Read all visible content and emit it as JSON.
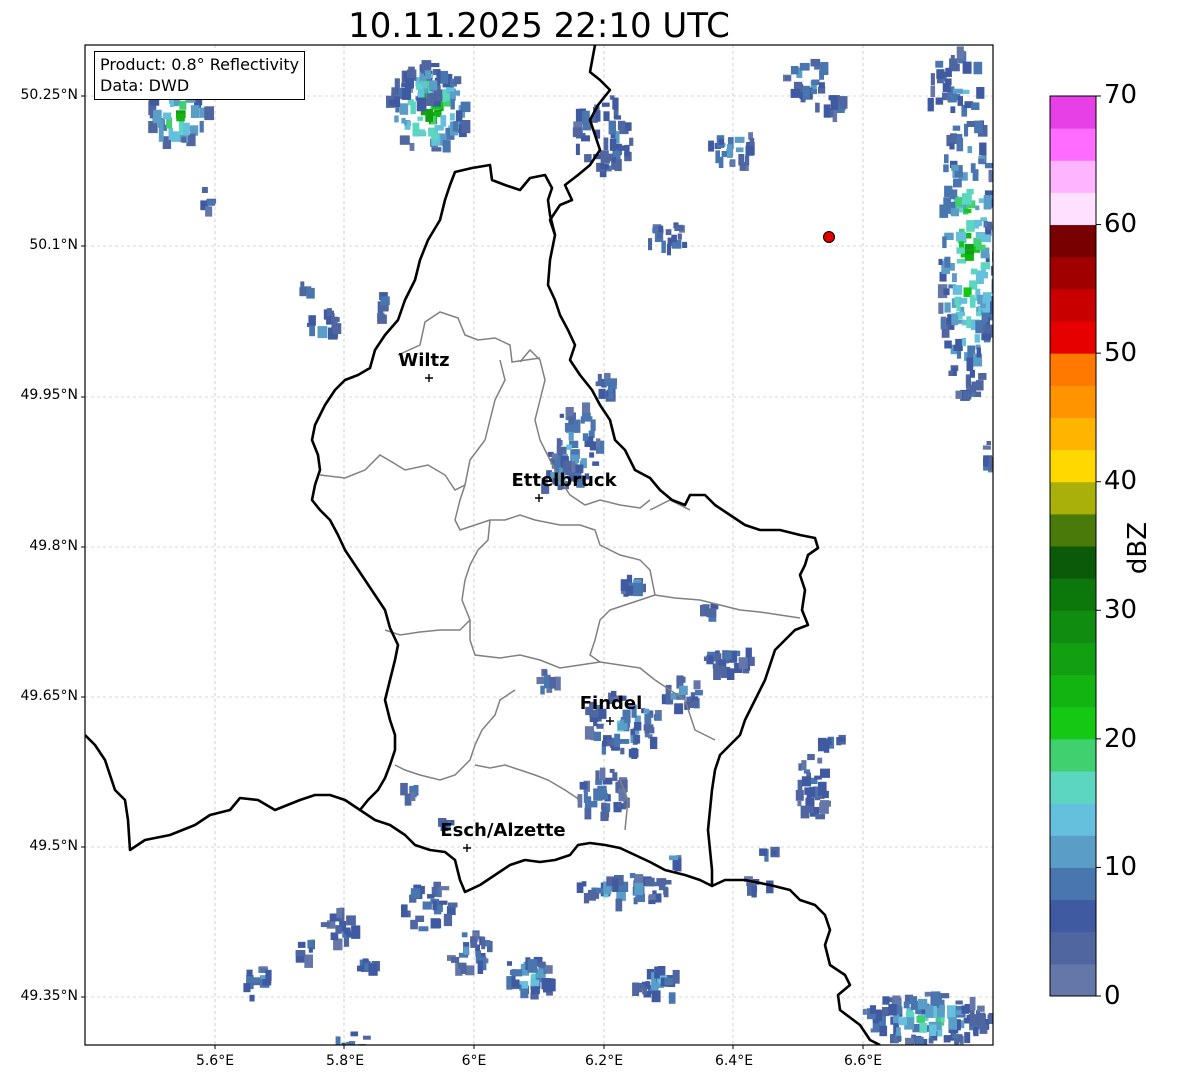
{
  "title": "10.11.2025 22:10 UTC",
  "info": {
    "product": "Product: 0.8° Reflectivity",
    "data": "Data: DWD"
  },
  "axes": {
    "lat_ticks": [
      "50.25°N",
      "50.1°N",
      "49.95°N",
      "49.8°N",
      "49.65°N",
      "49.5°N",
      "49.35°N"
    ],
    "lon_ticks": [
      "5.6°E",
      "5.8°E",
      "6°E",
      "6.2°E",
      "6.4°E",
      "6.6°E"
    ]
  },
  "colorbar": {
    "label": "dBZ",
    "tick_labels": [
      "0",
      "10",
      "20",
      "30",
      "40",
      "50",
      "60",
      "70"
    ],
    "colors": [
      "#6577a8",
      "#5066a0",
      "#3f5aa0",
      "#4a76b0",
      "#5a9ec8",
      "#64c0dc",
      "#5cd6c0",
      "#40d070",
      "#14c814",
      "#12b412",
      "#12a012",
      "#108c10",
      "#0c780c",
      "#0a5a0a",
      "#4a7a0a",
      "#aab00a",
      "#ffd800",
      "#ffb400",
      "#ff9400",
      "#ff7800",
      "#e60000",
      "#c80000",
      "#a00000",
      "#780000",
      "#ffe0ff",
      "#ffb4ff",
      "#ff6cff",
      "#e640e6"
    ]
  },
  "cities": [
    {
      "name": "Wiltz"
    },
    {
      "name": "Ettelbruck"
    },
    {
      "name": "Findel"
    },
    {
      "name": "Esch/Alzette"
    }
  ],
  "marker": {
    "color": "#e00000"
  }
}
